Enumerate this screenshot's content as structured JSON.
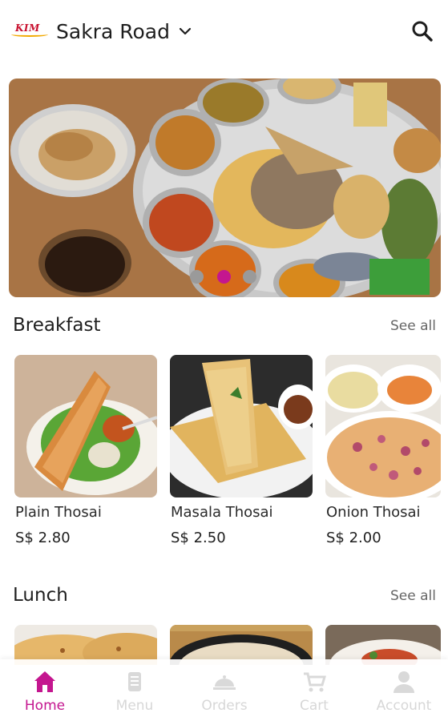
{
  "header": {
    "logo_text": "KIM",
    "location": "Sakra Road",
    "dropdown_icon": "chevron-down-icon",
    "search_icon": "search-icon"
  },
  "carousel": {
    "slides": 3,
    "active_slide": 2
  },
  "breakfast": {
    "title": "Breakfast",
    "see_all": "See all",
    "items": [
      {
        "name": "Plain Thosai",
        "price": "S$ 2.80"
      },
      {
        "name": "Masala Thosai",
        "price": "S$ 2.50"
      },
      {
        "name": "Onion Thosai",
        "price": "S$ 2.00"
      }
    ]
  },
  "lunch": {
    "title": "Lunch",
    "see_all": "See all"
  },
  "nav": {
    "items": [
      {
        "label": "Home",
        "icon": "home-icon",
        "active": true
      },
      {
        "label": "Menu",
        "icon": "menu-icon",
        "active": false
      },
      {
        "label": "Orders",
        "icon": "orders-icon",
        "active": false
      },
      {
        "label": "Cart",
        "icon": "cart-icon",
        "active": false
      },
      {
        "label": "Account",
        "icon": "account-icon",
        "active": false
      }
    ]
  },
  "colors": {
    "accent": "#c4168f",
    "inactive_nav": "#d7d7d7",
    "text": "#1e1e1e",
    "muted": "#666666"
  }
}
